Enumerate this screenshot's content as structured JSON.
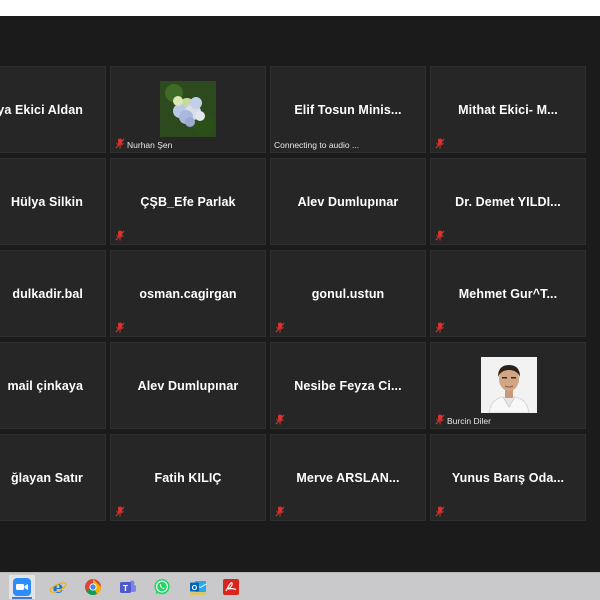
{
  "participants": [
    {
      "name": "ya Ekici Aldan"
    },
    {
      "label": "Nurhan Şen"
    },
    {
      "name": "Elif  Tosun  Minis...",
      "status": "Connecting to audio ..."
    },
    {
      "name": "Mithat  Ekici-  M..."
    },
    {
      "name": "Hülya Silkin"
    },
    {
      "name": "ÇŞB_Efe Parlak"
    },
    {
      "name": "Alev Dumlupınar"
    },
    {
      "name": "Dr.  Demet  YILDI..."
    },
    {
      "name": "dulkadir.bal"
    },
    {
      "name": "osman.cagirgan"
    },
    {
      "name": "gonul.ustun"
    },
    {
      "name": "Mehmet  Gur^T..."
    },
    {
      "name": "mail çinkaya"
    },
    {
      "name": "Alev Dumlupınar"
    },
    {
      "name": "Nesibe  Feyza  Ci..."
    },
    {
      "label": "Burcin Diler"
    },
    {
      "name": "ğlayan Satır"
    },
    {
      "name": "Fatih KILIÇ"
    },
    {
      "name": "Merve  ARSLAN..."
    },
    {
      "name": "Yunus Barış Oda..."
    }
  ],
  "taskbar": {
    "apps": [
      "zoom-icon",
      "internet-explorer-icon",
      "chrome-icon",
      "teams-icon",
      "whatsapp-icon",
      "outlook-icon",
      "acrobat-icon"
    ]
  },
  "colors": {
    "background": "#1b1b1b",
    "tile": "#262626",
    "muted_red": "#e0312b",
    "taskbar": "#c9c9cb"
  }
}
